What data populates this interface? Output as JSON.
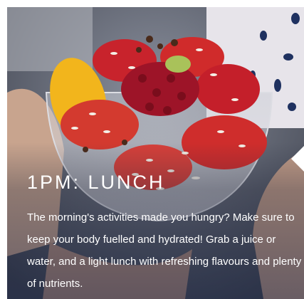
{
  "section": {
    "title": "1PM: LUNCH",
    "description": "The morning's activities made you hungry? Make sure to keep your body fuelled and hydrated! Grab a juice or water, and a light lunch with refreshing flavours and plenty of nutrients."
  },
  "colors": {
    "overlay": "#23283c",
    "text": "#ffffff",
    "strawberry": "#c8232c",
    "mango": "#f2b51c",
    "pomegranate": "#9d1428"
  },
  "photo": {
    "subject": "fruit-bowl-photo"
  }
}
